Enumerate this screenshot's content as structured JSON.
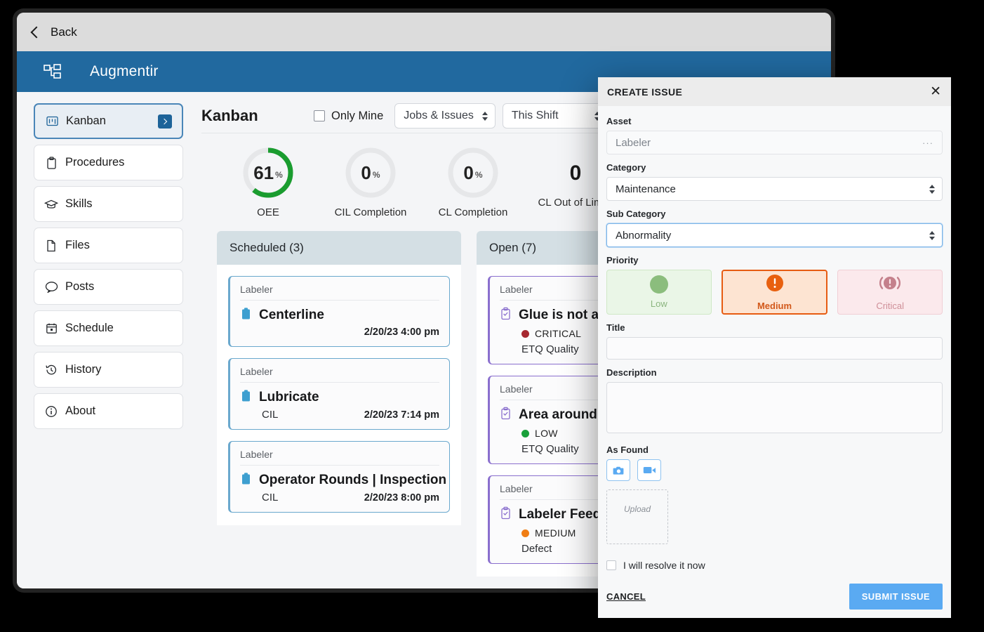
{
  "window": {
    "back_label": "Back",
    "app_title": "Augmentir"
  },
  "sidebar": {
    "items": [
      {
        "label": "Kanban",
        "icon": "kanban-icon",
        "active": true
      },
      {
        "label": "Procedures",
        "icon": "clipboard-icon",
        "active": false
      },
      {
        "label": "Skills",
        "icon": "graduation-cap-icon",
        "active": false
      },
      {
        "label": "Files",
        "icon": "file-icon",
        "active": false
      },
      {
        "label": "Posts",
        "icon": "chat-bubble-icon",
        "active": false
      },
      {
        "label": "Schedule",
        "icon": "calendar-icon",
        "active": false
      },
      {
        "label": "History",
        "icon": "history-icon",
        "active": false
      },
      {
        "label": "About",
        "icon": "info-icon",
        "active": false
      }
    ]
  },
  "toolbar": {
    "page_title": "Kanban",
    "only_mine_label": "Only Mine",
    "only_mine_checked": false,
    "type_filter": "Jobs & Issues",
    "shift_filter": "This Shift"
  },
  "kpis": [
    {
      "value": "61",
      "unit": "%",
      "caption": "OEE",
      "percent": 61,
      "color": "#1a9c2f"
    },
    {
      "value": "0",
      "unit": "%",
      "caption": "CIL Completion",
      "percent": 0,
      "color": "#1a9c2f"
    },
    {
      "value": "0",
      "unit": "%",
      "caption": "CL Completion",
      "percent": 0,
      "color": "#1a9c2f"
    },
    {
      "value": "0",
      "unit": "",
      "caption": "CL Out of Limits",
      "percent": null,
      "color": ""
    }
  ],
  "board": {
    "columns": [
      {
        "header": "Scheduled (3)",
        "cards": [
          {
            "asset": "Labeler",
            "title": "Centerline",
            "sub": "",
            "when": "2/20/23 4:00 pm",
            "kind": "job"
          },
          {
            "asset": "Labeler",
            "title": "Lubricate",
            "sub": "CIL",
            "when": "2/20/23 7:14 pm",
            "kind": "job"
          },
          {
            "asset": "Labeler",
            "title": "Operator Rounds | Inspection",
            "sub": "CIL",
            "when": "2/20/23 8:00 pm",
            "kind": "job"
          }
        ]
      },
      {
        "header": "Open (7)",
        "cards": [
          {
            "asset": "Labeler",
            "title": "Glue is not applying e",
            "priority": "CRITICAL",
            "priority_color": "#a62830",
            "category": "ETQ Quality",
            "kind": "issue"
          },
          {
            "asset": "Labeler",
            "title": "Area around labeler",
            "priority": "LOW",
            "priority_color": "#19a03a",
            "category": "ETQ Quality",
            "kind": "issue"
          },
          {
            "asset": "Labeler",
            "title": "Labeler Feed guard h",
            "priority": "MEDIUM",
            "priority_color": "#f07d14",
            "category": "Defect",
            "kind": "issue"
          }
        ]
      }
    ]
  },
  "modal": {
    "title": "CREATE ISSUE",
    "close_icon": "close-icon",
    "asset": {
      "label": "Asset",
      "value": "Labeler",
      "more": "···"
    },
    "category": {
      "label": "Category",
      "value": "Maintenance"
    },
    "sub_category": {
      "label": "Sub Category",
      "value": "Abnormality"
    },
    "priority": {
      "label": "Priority",
      "selected": "Medium",
      "options": [
        {
          "label": "Low",
          "icon": "circle-icon",
          "color": "#8bbd7d"
        },
        {
          "label": "Medium",
          "icon": "exclamation-circle-icon",
          "color": "#e8600f"
        },
        {
          "label": "Critical",
          "icon": "critical-alert-icon",
          "color": "#c4808b"
        }
      ]
    },
    "title_field": {
      "label": "Title",
      "value": "",
      "placeholder": ""
    },
    "description_field": {
      "label": "Description",
      "value": "",
      "placeholder": ""
    },
    "as_found": {
      "label": "As Found",
      "camera_icon": "camera-icon",
      "video_icon": "video-camera-icon",
      "upload_label": "Upload"
    },
    "resolve_now": {
      "label": "I will resolve it now",
      "checked": false
    },
    "cancel_label": "CANCEL",
    "submit_label": "SUBMIT ISSUE"
  }
}
